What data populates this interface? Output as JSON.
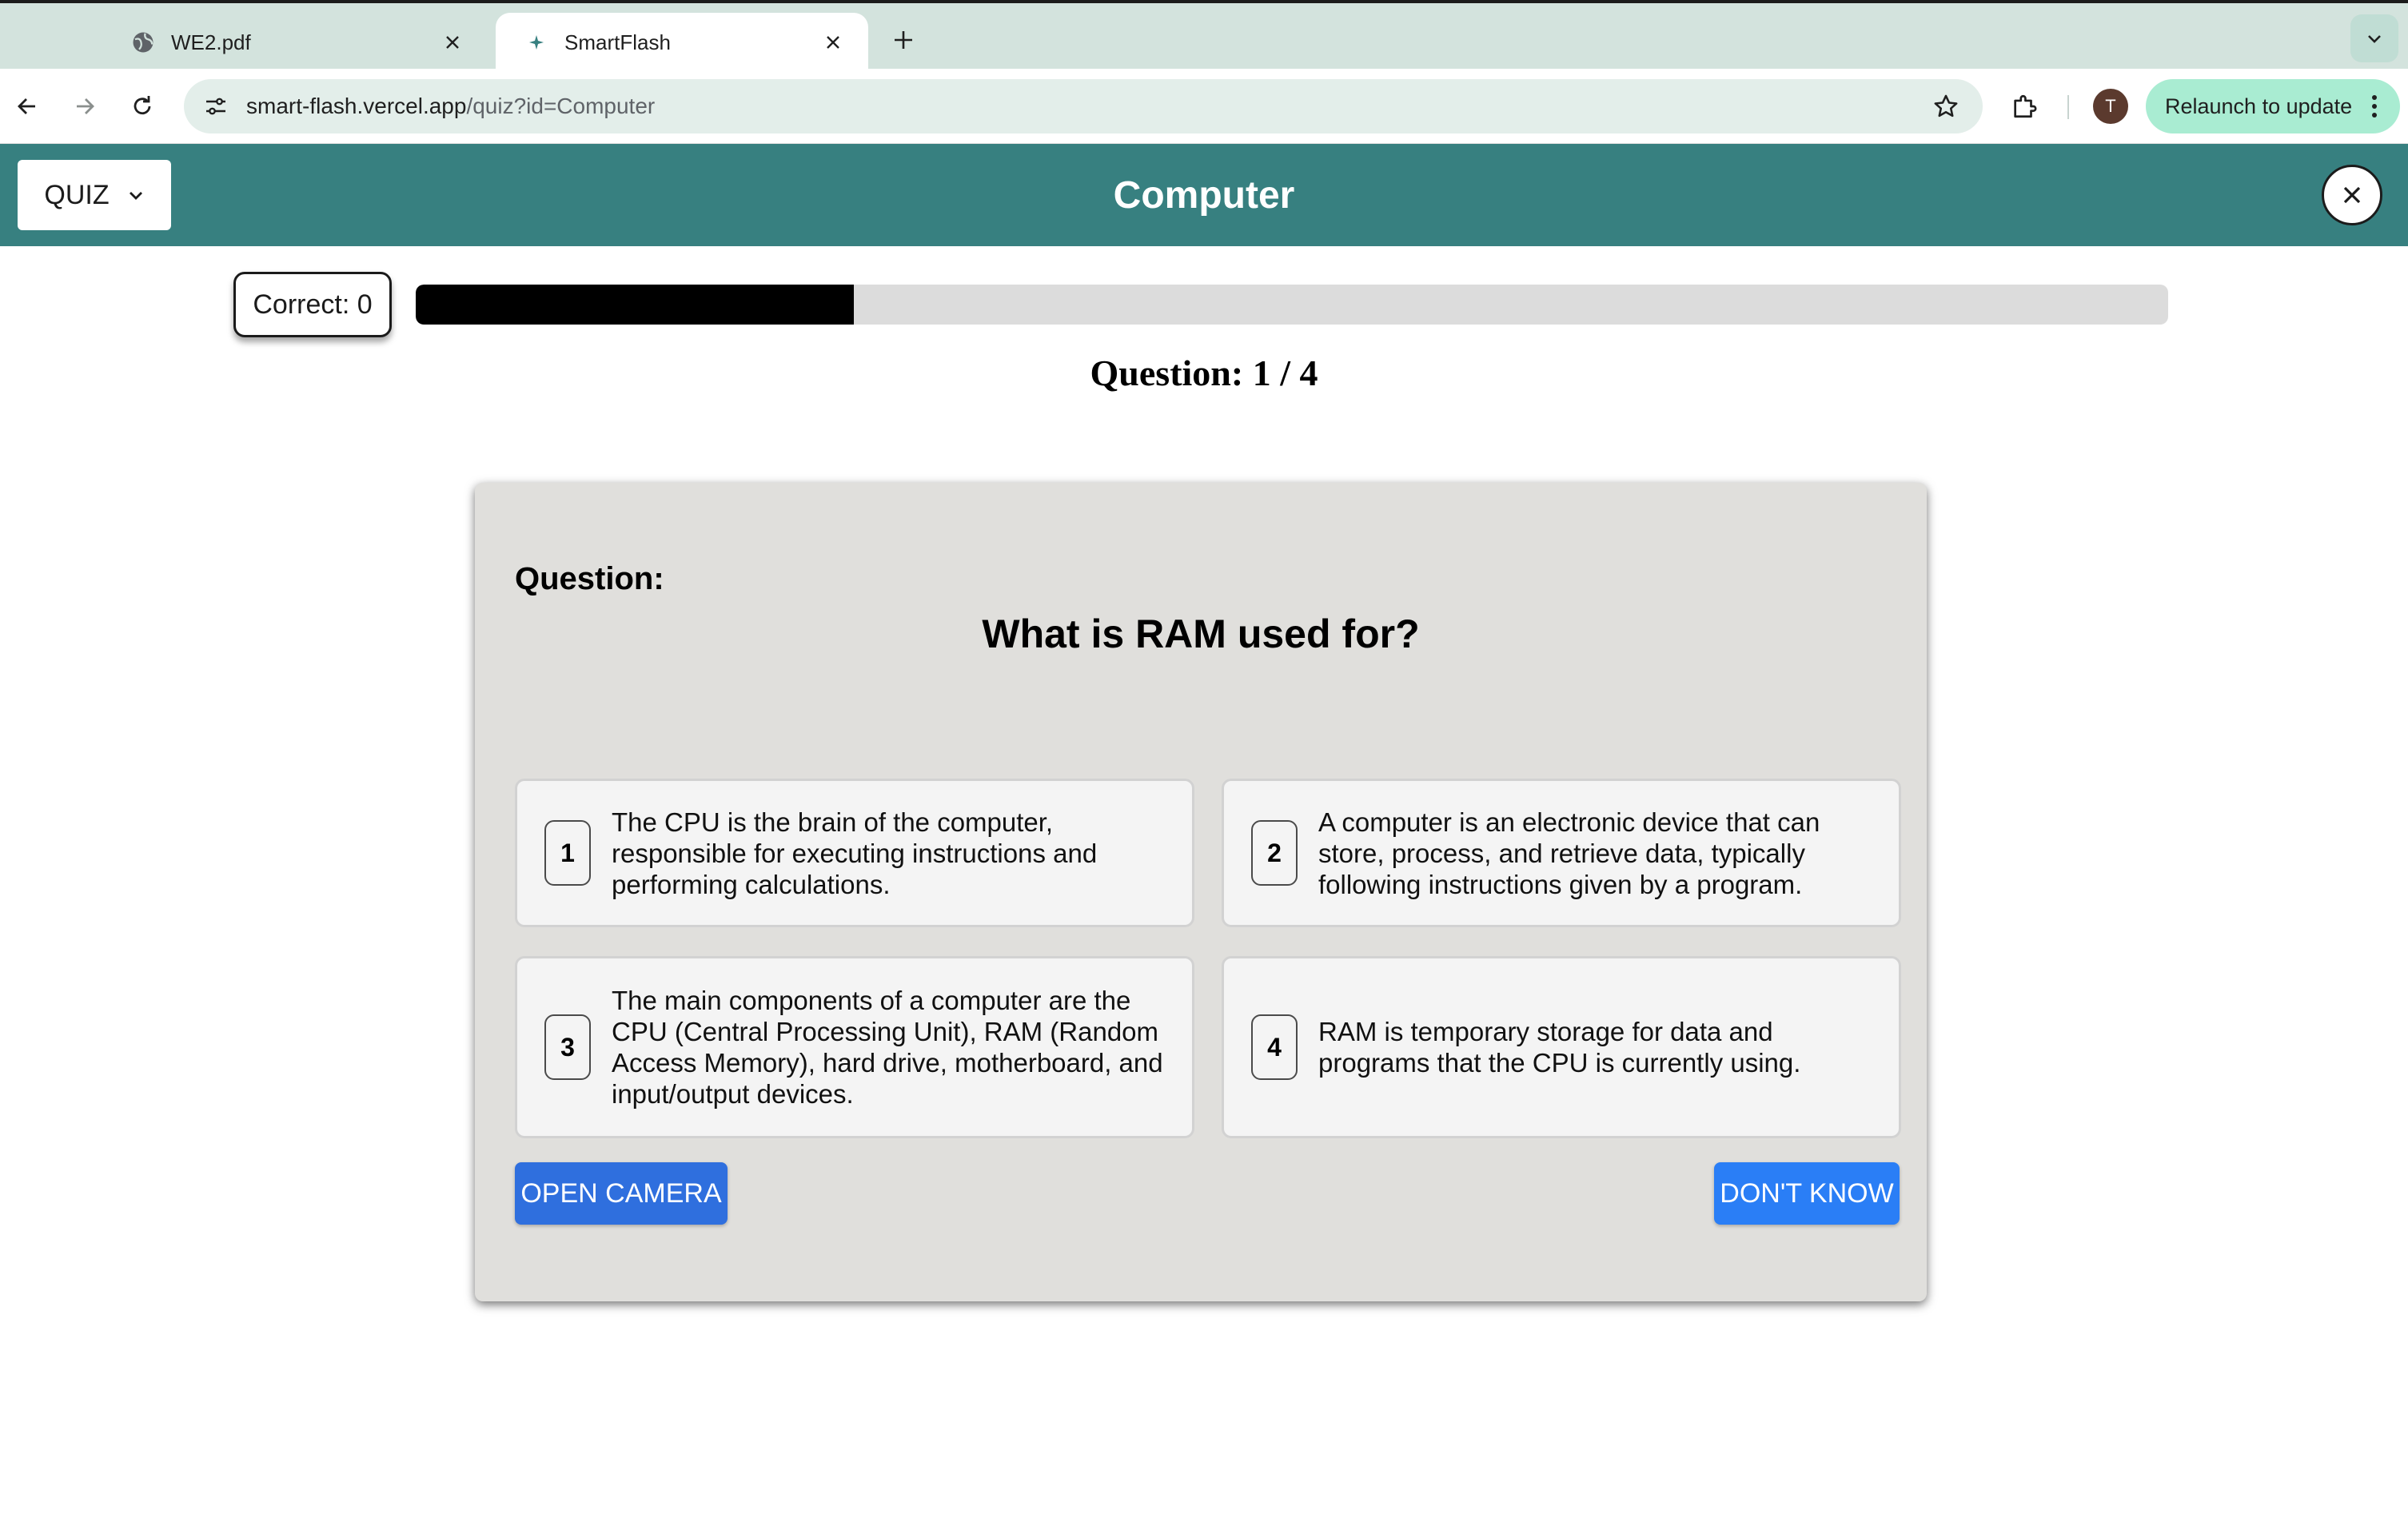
{
  "browser": {
    "tabs": [
      {
        "title": "WE2.pdf",
        "active": false,
        "icon": "globe-icon"
      },
      {
        "title": "SmartFlash",
        "active": true,
        "icon": "smartflash-favicon"
      }
    ],
    "url_host": "smart-flash.vercel.app",
    "url_path": "/quiz?id=Computer",
    "profile_initial": "T",
    "relaunch_label": "Relaunch to update"
  },
  "header": {
    "mode_label": "QUIZ",
    "title": "Computer",
    "color": "#378080"
  },
  "progress": {
    "correct_label": "Correct: 0",
    "fraction": 0.25,
    "question_label": "Question: 1 / 4"
  },
  "quiz": {
    "question_heading": "Question:",
    "question_text": "What is RAM used for?",
    "options": [
      {
        "number": "1",
        "text": "The CPU is the brain of the computer, responsible for executing instructions and performing calculations."
      },
      {
        "number": "2",
        "text": "A computer is an electronic device that can store, process, and retrieve data, typically following instructions given by a program."
      },
      {
        "number": "3",
        "text": "The main components of a computer are the CPU (Central Processing Unit), RAM (Random Access Memory), hard drive, motherboard, and input/output devices."
      },
      {
        "number": "4",
        "text": "RAM is temporary storage for data and programs that the CPU is currently using."
      }
    ],
    "open_camera_label": "OPEN CAMERA",
    "dont_know_label": "DON'T KNOW",
    "button_color": "#2f6fde"
  }
}
